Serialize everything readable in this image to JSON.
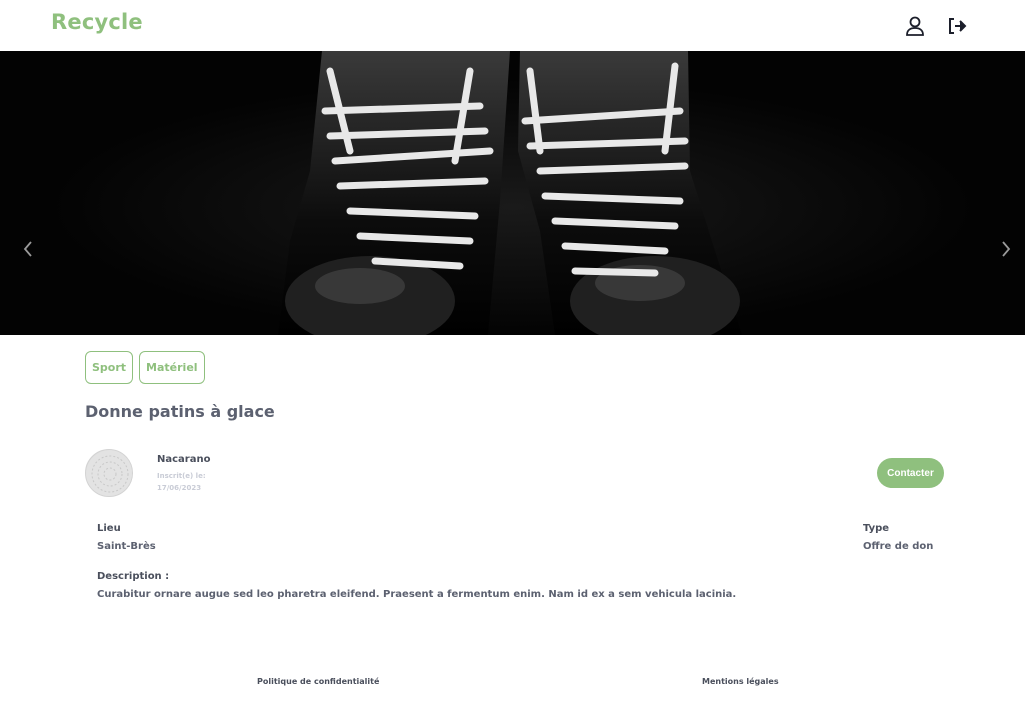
{
  "header": {
    "logo": "Recycle",
    "icons": {
      "profile": "user-icon",
      "logout": "logout-icon"
    }
  },
  "carousel": {
    "image_alt": "Patins à glace",
    "prev_icon": "chevron-left-icon",
    "next_icon": "chevron-right-icon"
  },
  "listing": {
    "tags": [
      "Sport",
      "Matériel"
    ],
    "title": "Donne patins à glace",
    "user": {
      "name": "Nacarano",
      "registered_label": "Inscrit(e) le:",
      "registered_date": "17/06/2023"
    },
    "contact_label": "Contacter",
    "location_label": "Lieu",
    "location_value": "Saint-Brès",
    "type_label": "Type",
    "type_value": "Offre de don",
    "description_label": "Description :",
    "description_value": "Curabitur ornare augue sed leo pharetra eleifend. Praesent a fermentum enim. Nam id ex a sem vehicula lacinia."
  },
  "footer": {
    "privacy": "Politique de confidentialité",
    "legal": "Mentions légales"
  },
  "colors": {
    "accent": "#8fc07e",
    "text": "#4a4f5c",
    "muted": "#c9ccd6"
  }
}
